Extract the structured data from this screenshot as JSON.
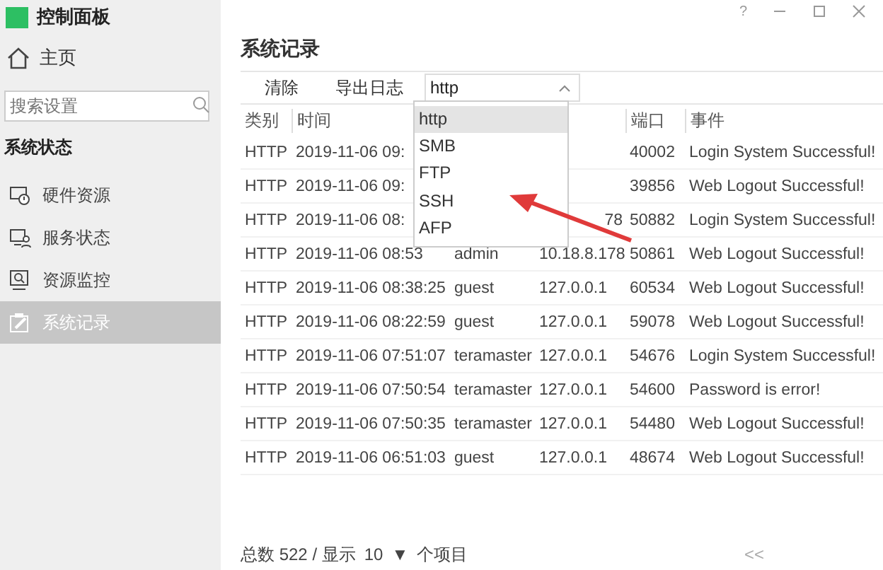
{
  "window": {
    "help": "?"
  },
  "sidebar": {
    "title": "控制面板",
    "home": "主页",
    "search": {
      "placeholder": "搜索设置"
    },
    "section": "系统状态",
    "items": [
      {
        "label": "硬件资源",
        "kind": "hardware",
        "selected": false
      },
      {
        "label": "服务状态",
        "kind": "service",
        "selected": false
      },
      {
        "label": "资源监控",
        "kind": "monitor",
        "selected": false
      },
      {
        "label": "系统记录",
        "kind": "log",
        "selected": true
      }
    ]
  },
  "main": {
    "title": "系统记录",
    "toolbar": [
      "清除",
      "导出日志"
    ],
    "filter": {
      "value": "http",
      "expanded": true,
      "options": [
        {
          "label": "http",
          "selected": true
        },
        {
          "label": "SMB",
          "selected": false
        },
        {
          "label": "FTP",
          "selected": false
        },
        {
          "label": "SSH",
          "selected": false
        },
        {
          "label": "AFP",
          "selected": false
        }
      ]
    },
    "table": {
      "columns": [
        "类别",
        "时间",
        null,
        null,
        "端口",
        "事件"
      ],
      "rows": [
        [
          "HTTP",
          "2019-11-06 09:",
          null,
          null,
          "40002",
          "Login System Successful!"
        ],
        [
          "HTTP",
          "2019-11-06 09:",
          null,
          null,
          "39856",
          "Web Logout Successful!"
        ],
        [
          "HTTP",
          "2019-11-06 08:",
          null,
          "78",
          "50882",
          "Login System Successful!"
        ],
        [
          "HTTP",
          "2019-11-06 08:53",
          "admin",
          "10.18.8.178",
          "50861",
          "Web Logout Successful!"
        ],
        [
          "HTTP",
          "2019-11-06 08:38:25",
          "guest",
          "127.0.0.1",
          "60534",
          "Web Logout Successful!"
        ],
        [
          "HTTP",
          "2019-11-06 08:22:59",
          "guest",
          "127.0.0.1",
          "59078",
          "Web Logout Successful!"
        ],
        [
          "HTTP",
          "2019-11-06 07:51:07",
          "teramaster",
          "127.0.0.1",
          "54676",
          "Login System Successful!"
        ],
        [
          "HTTP",
          "2019-11-06 07:50:54",
          "teramaster",
          "127.0.0.1",
          "54600",
          "Password is error!"
        ],
        [
          "HTTP",
          "2019-11-06 07:50:35",
          "teramaster",
          "127.0.0.1",
          "54480",
          "Web Logout Successful!"
        ],
        [
          "HTTP",
          "2019-11-06 06:51:03",
          "guest",
          "127.0.0.1",
          "48674",
          "Web Logout Successful!"
        ]
      ]
    },
    "footer": {
      "total": "总数 522 / 显示",
      "page_size": "10",
      "caret": "▼",
      "unit": "个项目",
      "pager": "<<"
    }
  }
}
